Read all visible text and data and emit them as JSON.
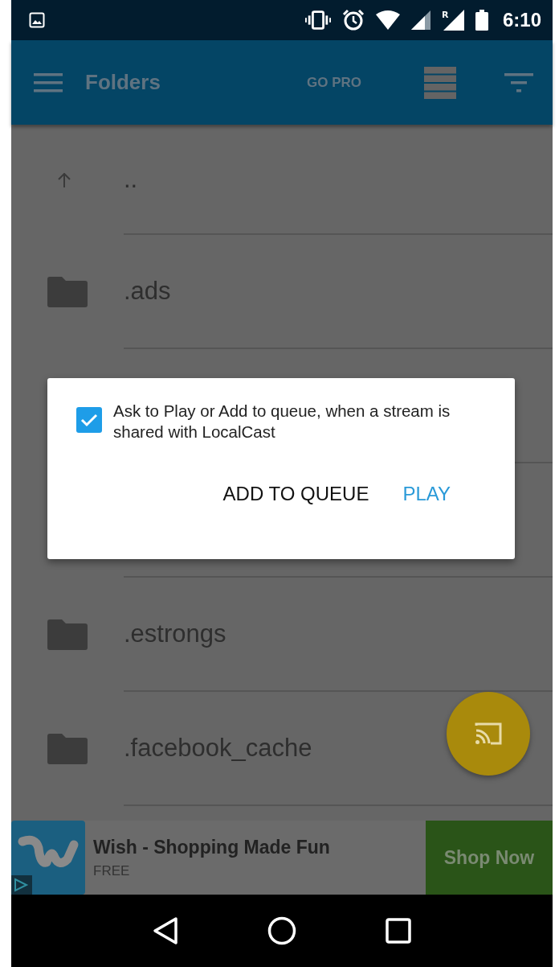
{
  "status_bar": {
    "roaming": "R",
    "time": "6:10"
  },
  "app_bar": {
    "title": "Folders",
    "action": "GO PRO"
  },
  "list": {
    "items": [
      {
        "kind": "up",
        "label": ".."
      },
      {
        "kind": "folder",
        "label": ".ads"
      },
      {
        "kind": "covered"
      },
      {
        "kind": "covered"
      },
      {
        "kind": "folder",
        "label": ".estrongs"
      },
      {
        "kind": "folder",
        "label": ".facebook_cache"
      }
    ]
  },
  "dialog": {
    "checked": true,
    "message": "Ask to Play or Add to queue, when a stream is shared with LocalCast",
    "buttons": [
      {
        "label": "ADD TO QUEUE",
        "primary": false
      },
      {
        "label": "PLAY",
        "primary": true
      }
    ]
  },
  "ad": {
    "title": "Wish - Shopping Made Fun",
    "subtitle": "FREE",
    "button": "Shop Now"
  }
}
